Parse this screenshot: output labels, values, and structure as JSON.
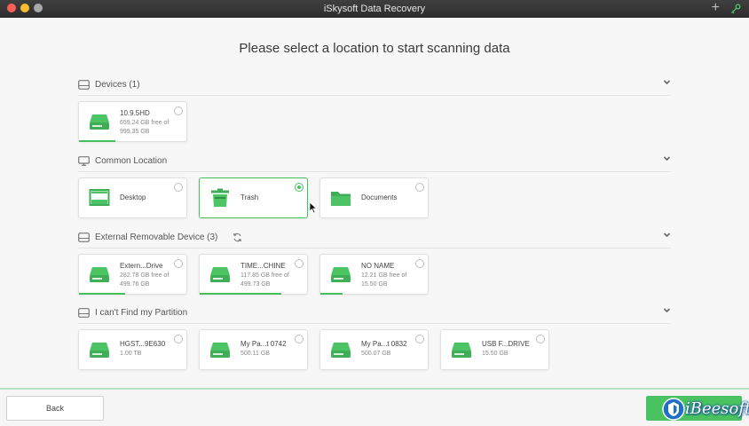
{
  "window": {
    "title": "iSkysoft Data Recovery"
  },
  "heading": "Please select a location to start scanning data",
  "sections": {
    "devices": {
      "title": "Devices (1)",
      "items": [
        {
          "name": "10.9.5HD",
          "line1": "659.24 GB free of",
          "line2": "999.35 GB",
          "usage": 0.34
        }
      ]
    },
    "common": {
      "title": "Common Location",
      "items": [
        {
          "name": "Desktop"
        },
        {
          "name": "Trash",
          "selected": true
        },
        {
          "name": "Documents"
        }
      ]
    },
    "external": {
      "title": "External Removable Device (3)",
      "items": [
        {
          "name": "Extern...Drive",
          "line1": "282.78 GB free of",
          "line2": "499.76 GB",
          "usage": 0.43
        },
        {
          "name": "TIME...CHINE",
          "line1": "117.85 GB free of",
          "line2": "499.73 GB",
          "usage": 0.76
        },
        {
          "name": "NO NAME",
          "line1": "12.21 GB free of",
          "line2": "15.50 GB",
          "usage": 0.21
        }
      ]
    },
    "partition": {
      "title": "I can't Find my Partition",
      "items": [
        {
          "name": "HGST...9E630",
          "line1": "1.00 TB"
        },
        {
          "name": "My Pa...t 0742",
          "line1": "500.11 GB"
        },
        {
          "name": "My Pa...t 0832",
          "line1": "500.07 GB"
        },
        {
          "name": "USB F...DRIVE",
          "line1": "15.50 GB"
        }
      ]
    }
  },
  "footer": {
    "back_label": "Back",
    "watermark": "iBeesoft"
  },
  "colors": {
    "accent": "#47c15e",
    "titlebar": "#333333"
  },
  "icons": [
    "plus-icon",
    "key-icon",
    "drive-icon",
    "monitor-icon",
    "desktop-icon",
    "trash-icon",
    "folder-icon",
    "refresh-icon",
    "chevron-down-icon"
  ]
}
